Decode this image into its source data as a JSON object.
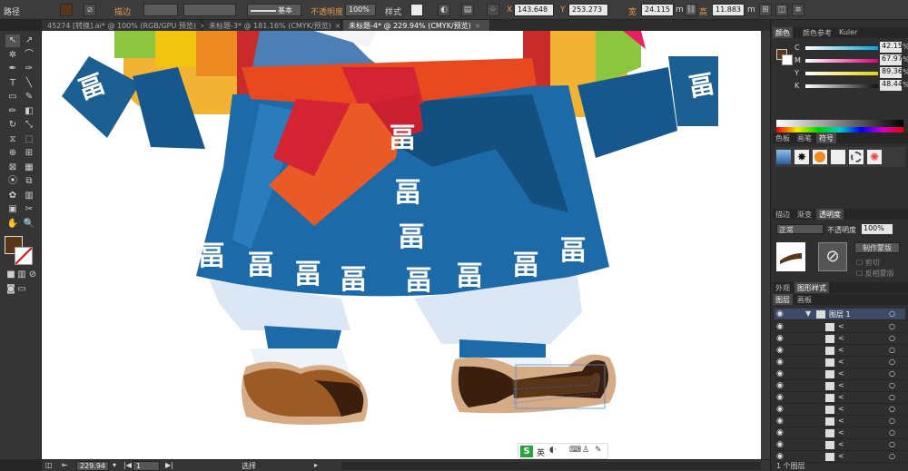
{
  "control_bar": {
    "object_type": "路径",
    "stroke_label": "描边",
    "stroke_style": "基本",
    "opacity_label": "不透明度",
    "opacity_value": "100%",
    "style_label": "样式",
    "x_label": "X",
    "x_value": "143.648",
    "y_label": "Y",
    "y_value": "253.273",
    "w_label": "宽",
    "w_value": "24.115",
    "h_label": "高",
    "h_value": "11.883",
    "unit": "m",
    "colors": {
      "fill": "#5a3618",
      "stroke": "#ffffff"
    }
  },
  "doc_tabs": [
    {
      "label": "45274 [转换].ai* @ 100% (RGB/GPU 预览)",
      "active": false
    },
    {
      "label": "未标题-3* @ 181.16% (CMYK/预览)",
      "active": false
    },
    {
      "label": "未标题-4* @ 229.94% (CMYK/预览)",
      "active": true
    }
  ],
  "tools": [
    "selection-tool",
    "direct-selection-tool",
    "magic-wand-tool",
    "lasso-tool",
    "pen-tool",
    "curvature-tool",
    "type-tool",
    "line-tool",
    "rectangle-tool",
    "paintbrush-tool",
    "pencil-tool",
    "eraser-tool",
    "rotate-tool",
    "scale-tool",
    "width-tool",
    "free-transform-tool",
    "shape-builder-tool",
    "perspective-tool",
    "mesh-tool",
    "gradient-tool",
    "eyedropper-tool",
    "blend-tool",
    "symbol-sprayer-tool",
    "column-graph-tool",
    "artboard-tool",
    "slice-tool",
    "hand-tool",
    "zoom-tool"
  ],
  "tool_icons": [
    "↖",
    "↗",
    "✲",
    "⌒",
    "✒",
    "✑",
    "T",
    "╲",
    "▭",
    "✎",
    "✏",
    "◧",
    "↻",
    "⤡",
    "⧖",
    "⬚",
    "⊕",
    "⊞",
    "⊠",
    "▦",
    "⦿",
    "⧉",
    "✿",
    "▥",
    "▣",
    "✂",
    "✋",
    "🔍"
  ],
  "toolbox": {
    "fill_color": "#5a3618"
  },
  "color_panel": {
    "tabs": [
      "颜色",
      "颜色参考",
      "Kuler"
    ],
    "channels": [
      {
        "name": "C",
        "value": "42.15",
        "color": "#00a6e0"
      },
      {
        "name": "M",
        "value": "67.97",
        "color": "#e0007a"
      },
      {
        "name": "Y",
        "value": "89.36",
        "color": "#e6d400"
      },
      {
        "name": "K",
        "value": "48.44",
        "color": "#111111"
      }
    ],
    "percent": "%"
  },
  "swatch_panel": {
    "tabs": [
      "色板",
      "画笔",
      "符号"
    ]
  },
  "transparency_panel": {
    "tabs": [
      "描边",
      "渐变",
      "透明度"
    ],
    "blend_mode": "正常",
    "opacity_label": "不透明度",
    "opacity_value": "100%",
    "make_mask_button": "制作蒙版",
    "clip_label": "剪切",
    "invert_label": "反相蒙版"
  },
  "appearance_panel": {
    "tabs": [
      "外观",
      "图形样式"
    ]
  },
  "layers_panel": {
    "tabs": [
      "图层",
      "画板"
    ],
    "layer_name": "图层 1",
    "rows": [
      "<",
      "<",
      "<",
      "<",
      "<",
      "<",
      "<",
      "<",
      "<",
      "<",
      "<",
      "<"
    ],
    "footer": "1 个图层"
  },
  "status_bar": {
    "zoom": "229.94",
    "artboard": "1",
    "tool_status": "选择"
  },
  "ime": {
    "lang": "英"
  }
}
